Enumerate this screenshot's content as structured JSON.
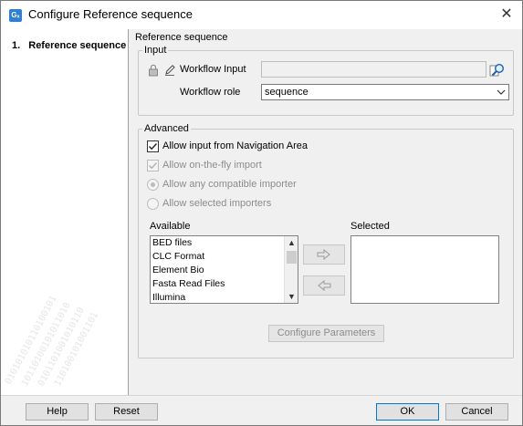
{
  "window": {
    "title": "Configure Reference sequence",
    "app_icon_text": "Gₓ"
  },
  "sidebar": {
    "steps": [
      {
        "number": "1.",
        "label": "Reference sequence"
      }
    ]
  },
  "main": {
    "section_title": "Reference sequence",
    "input_group": {
      "legend": "Input",
      "workflow_input_label": "Workflow Input",
      "workflow_input_value": "",
      "workflow_role_label": "Workflow role",
      "workflow_role_value": "sequence"
    },
    "advanced_group": {
      "legend": "Advanced",
      "allow_nav_area": {
        "label": "Allow input from Navigation Area",
        "checked": true,
        "enabled": true
      },
      "allow_on_the_fly": {
        "label": "Allow on-the-fly import",
        "checked": true,
        "enabled": false
      },
      "allow_any_importer": {
        "label": "Allow any compatible importer",
        "selected": true,
        "enabled": false
      },
      "allow_selected_importers": {
        "label": "Allow selected importers",
        "selected": false,
        "enabled": false
      },
      "available_label": "Available",
      "selected_label": "Selected",
      "available_items": [
        "BED files",
        "CLC Format",
        "Element Bio",
        "Fasta Read Files",
        "Illumina"
      ],
      "selected_items": [],
      "configure_parameters_label": "Configure Parameters"
    }
  },
  "footer": {
    "help_label": "Help",
    "reset_label": "Reset",
    "ok_label": "OK",
    "cancel_label": "Cancel"
  }
}
